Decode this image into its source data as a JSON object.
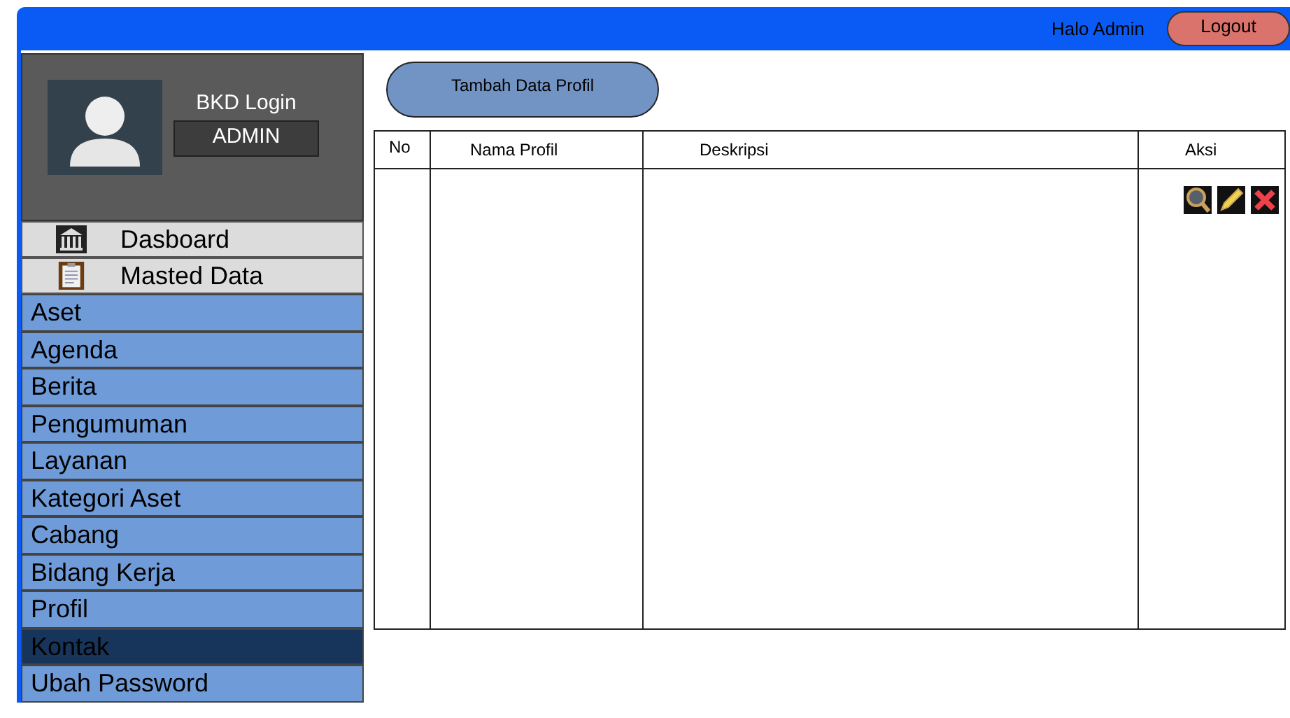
{
  "topbar": {
    "greeting": "Halo Admin",
    "logout": "Logout"
  },
  "profile": {
    "title": "BKD Login",
    "role": "ADMIN"
  },
  "sidebar": {
    "items": [
      {
        "kind": "header",
        "label": "Dasboard",
        "selected": false
      },
      {
        "kind": "header",
        "label": "Masted Data",
        "selected": false
      },
      {
        "kind": "item",
        "label": "Aset",
        "selected": false
      },
      {
        "kind": "item",
        "label": "Agenda",
        "selected": false
      },
      {
        "kind": "item",
        "label": "Berita",
        "selected": false
      },
      {
        "kind": "item",
        "label": "Pengumuman",
        "selected": false
      },
      {
        "kind": "item",
        "label": "Layanan",
        "selected": false
      },
      {
        "kind": "item",
        "label": "Kategori Aset",
        "selected": false
      },
      {
        "kind": "item",
        "label": "Cabang",
        "selected": false
      },
      {
        "kind": "item",
        "label": "Bidang Kerja",
        "selected": false
      },
      {
        "kind": "item",
        "label": "Profil",
        "selected": false
      },
      {
        "kind": "item",
        "label": "Kontak",
        "selected": true
      },
      {
        "kind": "item",
        "label": "Ubah Password",
        "selected": false
      }
    ]
  },
  "add_button": "Tambah Data Profil",
  "table": {
    "columns": [
      "No",
      "Nama Profil",
      "Deskripsi",
      "Aksi"
    ]
  }
}
